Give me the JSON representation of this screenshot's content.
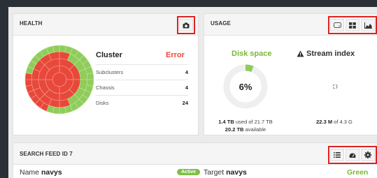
{
  "health": {
    "title": "HEALTH",
    "cluster_title": "Cluster",
    "cluster_status": "Error",
    "stats": [
      {
        "label": "Subclusters",
        "value": "4"
      },
      {
        "label": "Chassis",
        "value": "4"
      },
      {
        "label": "Disks",
        "value": "24"
      }
    ],
    "colors": {
      "ok": "#8fcc5a",
      "error": "#e8483a"
    }
  },
  "usage": {
    "title": "USAGE",
    "disk": {
      "heading": "Disk space",
      "percent_label": "6%",
      "percent_fraction": 0.06,
      "used_value": "1.4 TB",
      "used_suffix": " used of 21.7 TB",
      "available_value": "20.2 TB",
      "available_suffix": " available"
    },
    "stream": {
      "heading": "Stream index",
      "warning_icon": "warning-icon",
      "value": "22.3 M",
      "value_suffix": " of 4.3 G"
    }
  },
  "feed": {
    "title": "SEARCH FEED ID 7",
    "name_prefix": "Name ",
    "name_value": "navys",
    "badge": "Active",
    "target_prefix": "Target ",
    "target_value": "navys",
    "status": "Green"
  }
}
